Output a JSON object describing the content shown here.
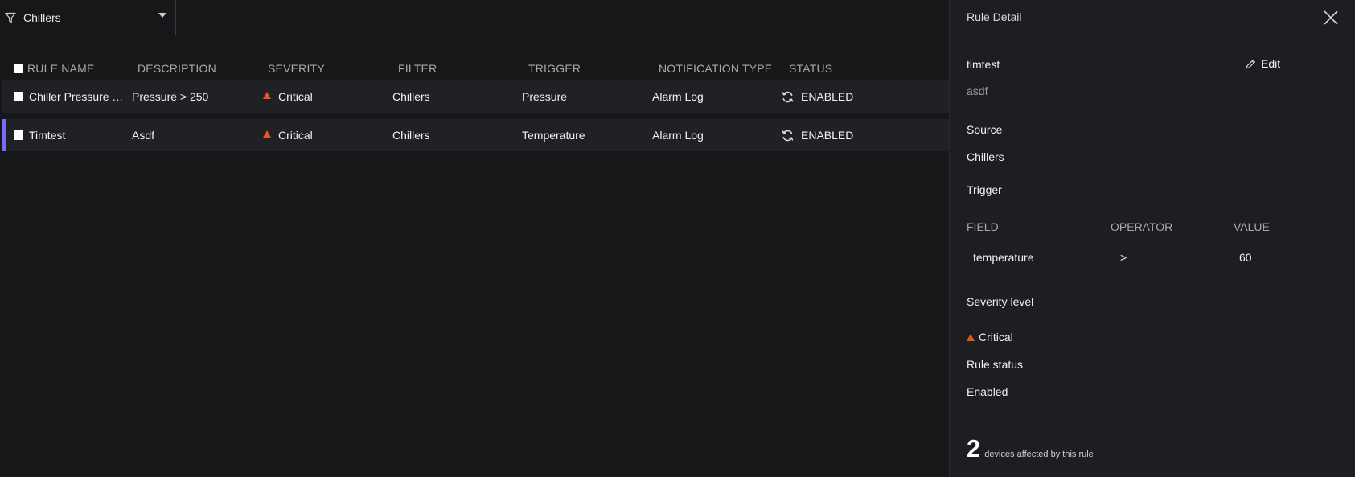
{
  "filter": {
    "icon": "funnel-icon",
    "selected": "Chillers"
  },
  "table": {
    "columns": [
      "RULE NAME",
      "DESCRIPTION",
      "SEVERITY",
      "FILTER",
      "TRIGGER",
      "NOTIFICATION TYPE",
      "STATUS"
    ],
    "rows": [
      {
        "name": "Chiller Pressure Too High",
        "description": "Pressure > 250",
        "severity": "Critical",
        "filter": "Chillers",
        "trigger": "Pressure",
        "notification": "Alarm Log",
        "status": "ENABLED",
        "selected": false
      },
      {
        "name": "Timtest",
        "description": "Asdf",
        "severity": "Critical",
        "filter": "Chillers",
        "trigger": "Temperature",
        "notification": "Alarm Log",
        "status": "ENABLED",
        "selected": true
      }
    ]
  },
  "detail": {
    "title": "Rule Detail",
    "rule_name": "timtest",
    "rule_description": "asdf",
    "edit_label": "Edit",
    "source_label": "Source",
    "source_value": "Chillers",
    "trigger_label": "Trigger",
    "trigger_columns": [
      "FIELD",
      "OPERATOR",
      "VALUE"
    ],
    "trigger_rows": [
      {
        "field": "temperature",
        "operator": ">",
        "value": "60"
      }
    ],
    "severity_label": "Severity level",
    "severity_value": "Critical",
    "status_label": "Rule status",
    "status_value": "Enabled",
    "devices_count": "2",
    "devices_caption": "devices affected by this rule"
  },
  "colors": {
    "background": "#161719",
    "panel": "#1d1e21",
    "row": "#202124",
    "accent": "#7b6cf6",
    "critical": "#e5561f"
  }
}
